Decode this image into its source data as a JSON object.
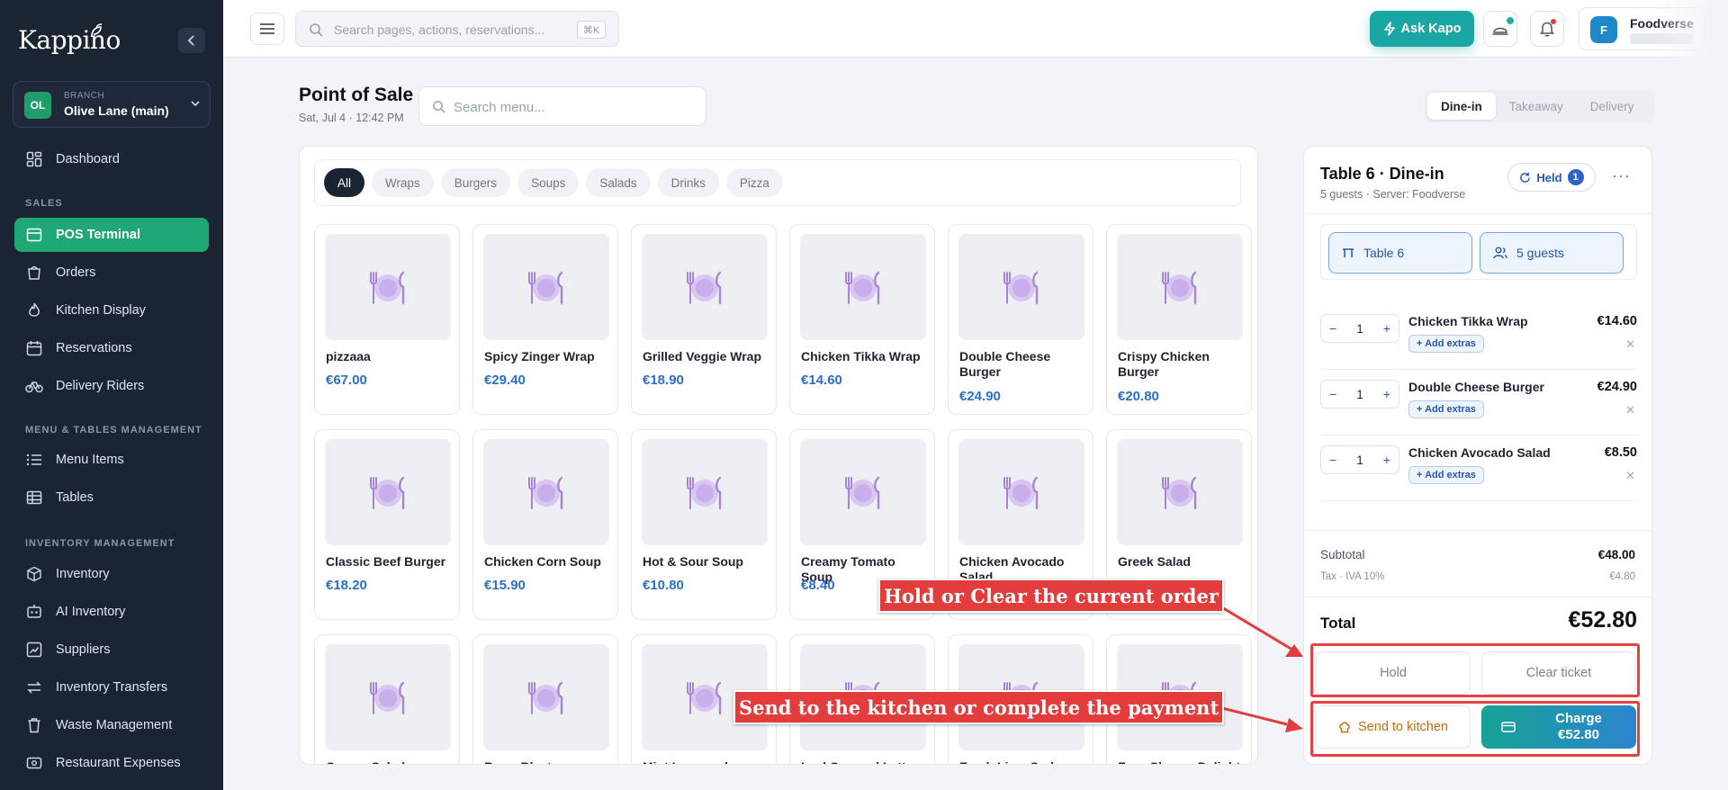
{
  "brand": {
    "logo": "Kappino"
  },
  "branch": {
    "caption": "BRANCH",
    "initials": "OL",
    "name": "Olive Lane (main)"
  },
  "sidebar": {
    "sales_label": "SALES",
    "menu_label": "MENU & TABLES MANAGEMENT",
    "inventory_label": "INVENTORY MANAGEMENT",
    "items": [
      {
        "label": "Dashboard",
        "icon": "dashboard-icon"
      },
      {
        "label": "POS Terminal",
        "icon": "pos-terminal-icon",
        "active": true
      },
      {
        "label": "Orders",
        "icon": "orders-icon"
      },
      {
        "label": "Kitchen Display",
        "icon": "flame-icon"
      },
      {
        "label": "Reservations",
        "icon": "calendar-icon"
      },
      {
        "label": "Delivery Riders",
        "icon": "bike-icon"
      },
      {
        "label": "Menu Items",
        "icon": "list-icon"
      },
      {
        "label": "Tables",
        "icon": "table-icon"
      },
      {
        "label": "Inventory",
        "icon": "box-icon"
      },
      {
        "label": "AI Inventory",
        "icon": "ai-icon"
      },
      {
        "label": "Suppliers",
        "icon": "trend-icon"
      },
      {
        "label": "Inventory Transfers",
        "icon": "transfer-icon"
      },
      {
        "label": "Waste Management",
        "icon": "trash-icon"
      },
      {
        "label": "Restaurant Expenses",
        "icon": "cash-icon"
      }
    ]
  },
  "topbar": {
    "search_placeholder": "Search pages, actions, reservations...",
    "shortcut": "⌘K",
    "ask_label": "Ask Kapo",
    "user_initial": "F",
    "user_name": "Foodverse"
  },
  "page": {
    "title": "Point of Sale",
    "subtitle": "Sat, Jul 4 · 12:42 PM",
    "menu_search_placeholder": "Search menu...",
    "modes": [
      "Dine-in",
      "Takeaway",
      "Delivery"
    ],
    "active_mode": "Dine-in"
  },
  "categories": [
    "All",
    "Wraps",
    "Burgers",
    "Soups",
    "Salads",
    "Drinks",
    "Pizza"
  ],
  "active_category": "All",
  "menu_items": [
    {
      "name": "pizzaaa",
      "price": "€67.00"
    },
    {
      "name": "Spicy Zinger Wrap",
      "price": "€29.40"
    },
    {
      "name": "Grilled Veggie Wrap",
      "price": "€18.90"
    },
    {
      "name": "Chicken Tikka Wrap",
      "price": "€14.60"
    },
    {
      "name": "Double Cheese Burger",
      "price": "€24.90"
    },
    {
      "name": "Crispy Chicken Burger",
      "price": "€20.80"
    },
    {
      "name": "Classic Beef Burger",
      "price": "€18.20"
    },
    {
      "name": "Chicken Corn Soup",
      "price": "€15.90"
    },
    {
      "name": "Hot & Sour Soup",
      "price": "€10.80"
    },
    {
      "name": "Creamy Tomato Soup",
      "price": "€8.40"
    },
    {
      "name": "Chicken Avocado Salad",
      "price": ""
    },
    {
      "name": "Greek Salad",
      "price": ""
    },
    {
      "name": "Caesar Salad",
      "price": ""
    },
    {
      "name": "Berry Blast",
      "price": ""
    },
    {
      "name": "Mint Lemonade",
      "price": ""
    },
    {
      "name": "Iced Caramel Latte",
      "price": ""
    },
    {
      "name": "Fresh Lime Soda",
      "price": ""
    },
    {
      "name": "Four Cheese Delight",
      "price": ""
    }
  ],
  "order": {
    "title": "Table 6 · Dine-in",
    "subtitle": "5 guests · Server: Foodverse",
    "held_label": "Held",
    "held_count": "1",
    "table_chip": "Table 6",
    "guests_chip": "5 guests",
    "add_extras": "+ Add extras",
    "lines": [
      {
        "name": "Chicken Tikka Wrap",
        "qty": "1",
        "price": "€14.60"
      },
      {
        "name": "Double Cheese Burger",
        "qty": "1",
        "price": "€24.90"
      },
      {
        "name": "Chicken Avocado Salad",
        "qty": "1",
        "price": "€8.50"
      }
    ],
    "subtotal_label": "Subtotal",
    "subtotal": "€48.00",
    "tax_label": "Tax · IVA 10%",
    "tax": "€4.80",
    "total_label": "Total",
    "total": "€52.80",
    "hold_label": "Hold",
    "clear_label": "Clear ticket",
    "send_label": "Send to kitchen",
    "charge_label": "Charge",
    "charge_amount": "€52.80"
  },
  "annotations": {
    "callout_top": "Hold or Clear the current order",
    "callout_bottom": "Send to the kitchen or complete the payment"
  },
  "colors": {
    "sidebar": "#1b2433",
    "accent_green": "#1fa873",
    "ask_teal": "#1aa6a3",
    "price_blue": "#2c6fc9",
    "highlight_red": "#e64040"
  }
}
